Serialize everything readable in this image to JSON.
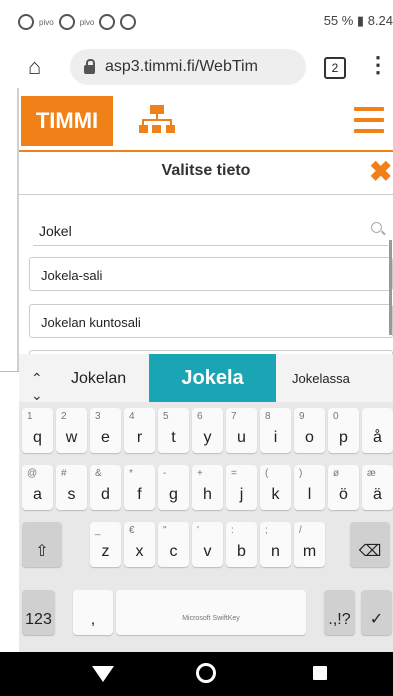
{
  "status_bar": {
    "left_text": "pivo",
    "right_text": "55 % ▮ 8.24"
  },
  "browser": {
    "url": "asp3.timmi.fi/WebTim",
    "tab_count": "2"
  },
  "app": {
    "logo_text": "TIMMI",
    "dialog_title": "Valitse tieto",
    "close_symbol": "✖",
    "accent": "#f08018"
  },
  "search": {
    "value": "Jokel"
  },
  "results": [
    "Jokela-sali",
    "Jokelan kuntosali"
  ],
  "keyboard": {
    "suggestions": [
      "Jokelan",
      "Jokela",
      "Jokelassa"
    ],
    "highlight": "#1aa5b4",
    "space_label": "Microsoft SwiftKey",
    "row1": [
      [
        "1",
        "q"
      ],
      [
        "2",
        "w"
      ],
      [
        "3",
        "e"
      ],
      [
        "4",
        "r"
      ],
      [
        "5",
        "t"
      ],
      [
        "6",
        "y"
      ],
      [
        "7",
        "u"
      ],
      [
        "8",
        "i"
      ],
      [
        "9",
        "o"
      ],
      [
        "0",
        "p"
      ],
      [
        "",
        "å"
      ]
    ],
    "row2": [
      [
        "@",
        "a"
      ],
      [
        "#",
        "s"
      ],
      [
        "&",
        "d"
      ],
      [
        "*",
        "f"
      ],
      [
        "-",
        "g"
      ],
      [
        "+",
        "h"
      ],
      [
        "=",
        "j"
      ],
      [
        "(",
        "k"
      ],
      [
        ")",
        "l"
      ],
      [
        "ø",
        "ö"
      ],
      [
        "æ",
        "ä"
      ]
    ],
    "row3": [
      [
        "_",
        "z"
      ],
      [
        "€",
        "x"
      ],
      [
        "\"",
        "c"
      ],
      [
        "'",
        "v"
      ],
      [
        ":",
        "b"
      ],
      [
        ";",
        "n"
      ],
      [
        "/",
        "m"
      ]
    ],
    "num_label": "123",
    "comma_label": ",",
    "punct_label": ".,!?",
    "shift_icon": "⇧",
    "backspace_icon": "⌫",
    "enter_icon": "✓"
  }
}
